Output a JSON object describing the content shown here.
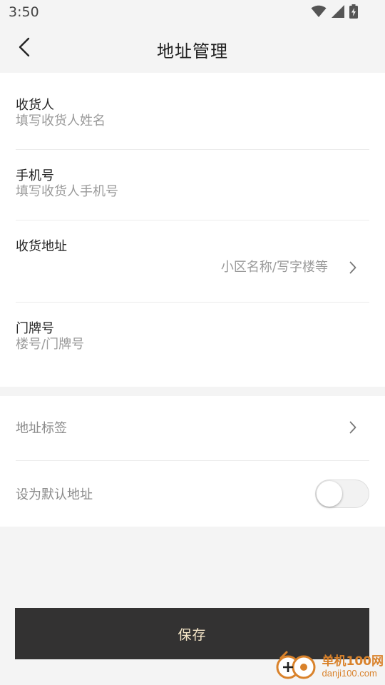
{
  "status_bar": {
    "time": "3:50",
    "icons": [
      "wifi-icon",
      "cell-signal-icon",
      "battery-charging-icon"
    ]
  },
  "header": {
    "title": "地址管理",
    "back_icon": "chevron-left-icon"
  },
  "form": {
    "consignee": {
      "label": "收货人",
      "placeholder": "填写收货人姓名"
    },
    "phone": {
      "label": "手机号",
      "placeholder": "填写收货人手机号"
    },
    "address": {
      "label": "收货地址",
      "placeholder": "小区名称/写字楼等"
    },
    "door_number": {
      "label": "门牌号",
      "placeholder": "楼号/门牌号"
    }
  },
  "options": {
    "address_tag": {
      "label": "地址标签"
    },
    "default_address": {
      "label": "设为默认地址",
      "enabled": false
    }
  },
  "save_button": {
    "label": "保存"
  },
  "watermark": {
    "name": "单机100网",
    "domain": "danji100.com"
  },
  "colors": {
    "page_background": "#f4f4f4",
    "card_background": "#ffffff",
    "save_button_background": "#333232",
    "save_button_text": "#f5e6c8",
    "placeholder_text": "#9a9a9a",
    "watermark_orange": "#d9822b"
  }
}
